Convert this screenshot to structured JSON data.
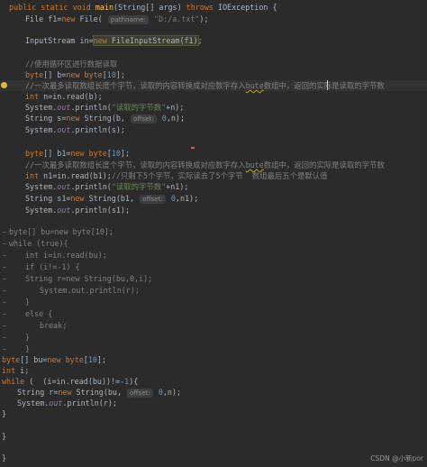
{
  "lines": [
    {
      "text": "public static void main(String[] args) throws IOException {"
    },
    {
      "text": "File f1=new File( pathname: \"D:/a.txt\");"
    },
    {
      "text": "InputStream in=new FileInputStream(f1);"
    },
    {
      "text": "//使用循环区进行数据读取"
    },
    {
      "text": "byte[] b=new byte[10];"
    },
    {
      "text": "//一次最多读取数组长度个字节，读取的内容转换成对应数字存入bute数组中，返回的实际是读取的字节数"
    },
    {
      "text": "int n=in.read(b);"
    },
    {
      "text": "System.out.println(\"读取的字节数\"+n);"
    },
    {
      "text": "String s=new String(b, offset: 0,n);"
    },
    {
      "text": "System.out.println(s);"
    },
    {
      "text": "byte[] b1=new byte[10];"
    },
    {
      "text": "//一次最多读取数组长度个字节，读取的内容转换成对应数字存入bute数组中，返回的实际是读取的字节数"
    },
    {
      "text": "int n1=in.read(b1);//只剩下5个字节，实际读去了5个字节  数组最后五个是默认值"
    },
    {
      "text": "System.out.println(\"读取的字节数\"+n1);"
    },
    {
      "text": "String s1=new String(b1, offset: 0,n1);"
    },
    {
      "text": "System.out.println(s1);"
    },
    {
      "text": "byte[] bu=new byte[10];"
    },
    {
      "text": "while (true){"
    },
    {
      "text": "int i=in.read(bu);"
    },
    {
      "text": "if (i!=-1) {"
    },
    {
      "text": "String r=new String(bu,0,i);"
    },
    {
      "text": "System.out.println(r);"
    },
    {
      "text": "}"
    },
    {
      "text": "else {"
    },
    {
      "text": "break;"
    },
    {
      "text": "}"
    },
    {
      "text": "}"
    },
    {
      "text": "byte[] bu=new byte[10];"
    },
    {
      "text": "int i;"
    },
    {
      "text": "while ( (i=in.read(bu))!=-1){"
    },
    {
      "text": "String r=new String(bu, offset: 0,n);"
    },
    {
      "text": "System.out.println(r);"
    },
    {
      "text": "}"
    },
    {
      "text": "}"
    }
  ],
  "hints": {
    "pathname": "pathname:",
    "offset": "offset:"
  },
  "watermark": "CSDN @小新por",
  "colors": {
    "background": "#2b2b2b",
    "keyword": "#cc7832",
    "string": "#6a8759",
    "method": "#ffc66d",
    "comment": "#629755",
    "number": "#6897bb",
    "field": "#9876aa"
  }
}
